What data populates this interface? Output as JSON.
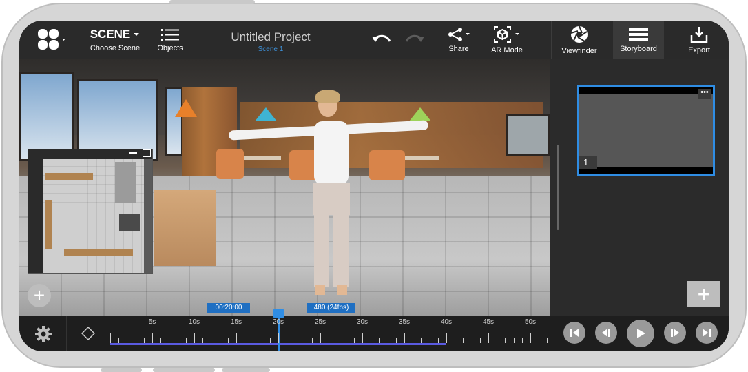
{
  "toolbar": {
    "scene_label": "SCENE",
    "choose_scene_label": "Choose Scene",
    "objects_label": "Objects",
    "project_title": "Untitled Project",
    "scene_subtitle": "Scene 1",
    "share_label": "Share",
    "ar_mode_label": "AR Mode",
    "viewfinder_label": "Viewfinder",
    "storyboard_label": "Storyboard",
    "export_label": "Export"
  },
  "icons": {
    "app_menu": "grid-icon",
    "objects": "list-icon",
    "undo": "undo-icon",
    "redo": "redo-icon",
    "share": "share-icon",
    "ar_mode": "ar-cube-icon",
    "viewfinder": "aperture-icon",
    "storyboard": "storyboard-icon",
    "export": "export-icon",
    "settings": "gear-icon",
    "keyframe": "diamond-icon"
  },
  "storyboard": {
    "shots": [
      {
        "number": "1"
      }
    ],
    "add_label": "+"
  },
  "viewport": {
    "add_label": "+"
  },
  "timeline": {
    "tick_labels": [
      "5s",
      "10s",
      "15s",
      "20s",
      "25s",
      "30s",
      "35s",
      "40s",
      "45s",
      "50s"
    ],
    "current_time": "00:20:00",
    "current_frame": "480 (24fps)"
  },
  "colors": {
    "accent": "#2f8de4",
    "range": "#5a5ae0",
    "toolbar_bg": "#2a2a2a"
  }
}
